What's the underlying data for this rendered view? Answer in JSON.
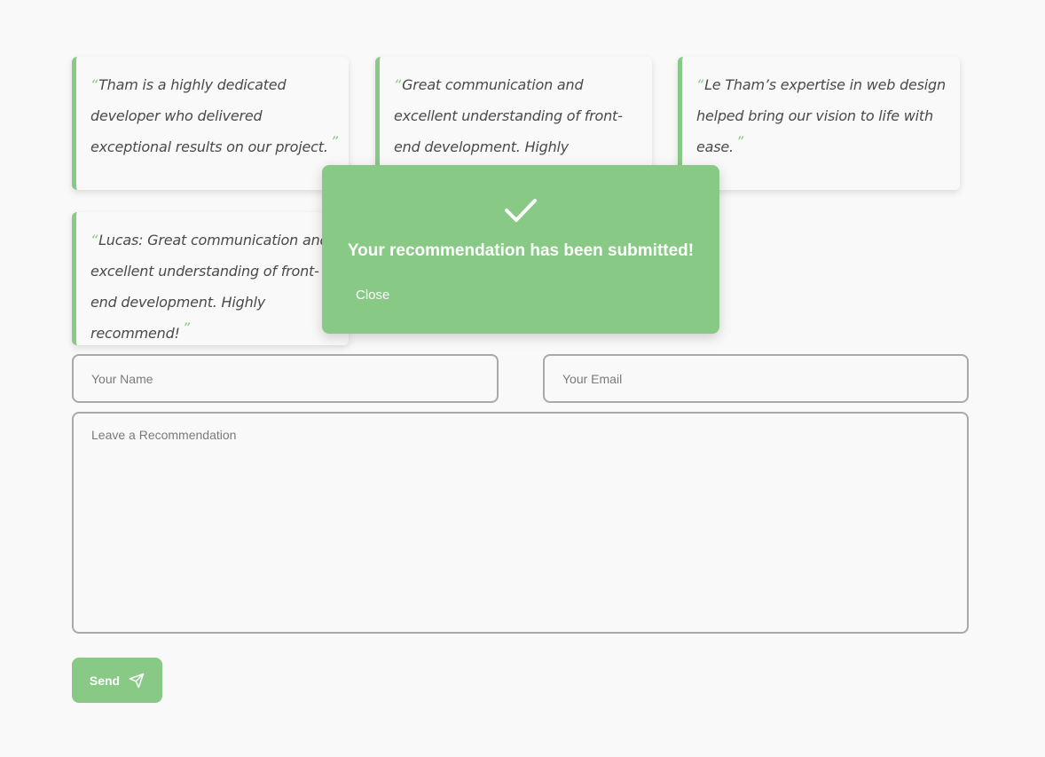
{
  "colors": {
    "accent": "#88c985",
    "background": "#f9f9f9",
    "border": "#a9a9a9"
  },
  "recommendations": [
    {
      "text": "Tham is a highly dedicated developer who delivered exceptional results on our project."
    },
    {
      "text": "Great communication and excellent understanding of front-end development. Highly recommend!"
    },
    {
      "text": "Le Tham’s expertise in web design helped bring our vision to life with ease."
    },
    {
      "text": "Lucas: Great communication and excellent understanding of front-end development. Highly recommend!"
    }
  ],
  "quote_marks": {
    "open": "“",
    "close": "”"
  },
  "form": {
    "name_placeholder": "Your Name",
    "email_placeholder": "Your Email",
    "recommendation_placeholder": "Leave a Recommendation",
    "send_label": "Send",
    "send_icon": "send-icon"
  },
  "modal": {
    "icon": "check-icon",
    "message": "Your recommendation has been submitted!",
    "close_label": "Close"
  }
}
